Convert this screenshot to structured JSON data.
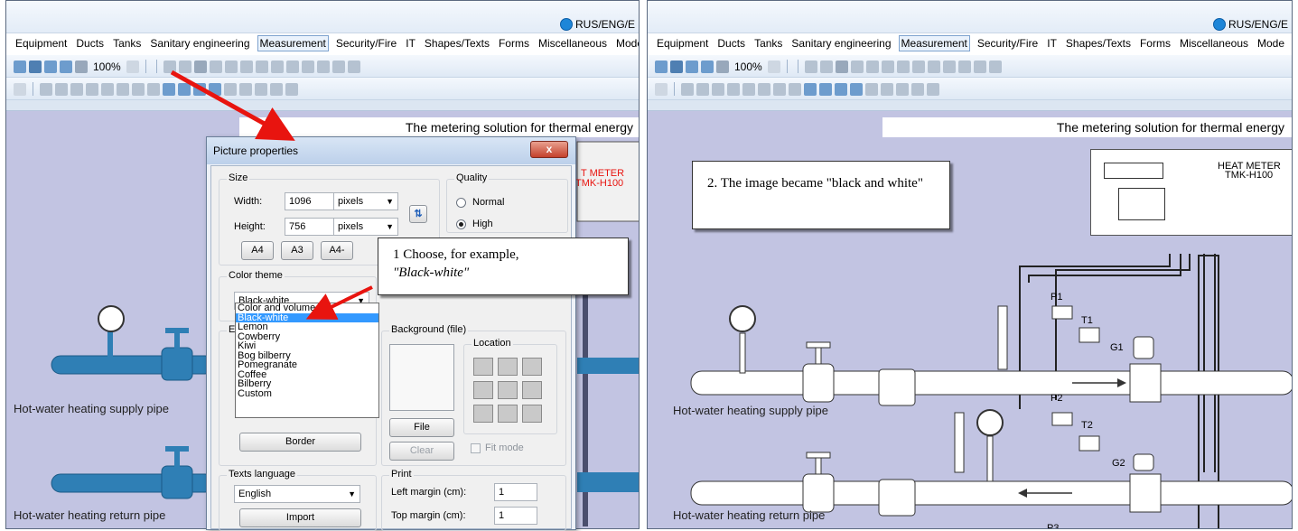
{
  "window": {
    "lang_selector": "RUS/ENG/E",
    "menu": [
      "Equipment",
      "Ducts",
      "Tanks",
      "Sanitary engineering",
      "Measurement",
      "Security/Fire",
      "IT",
      "Shapes/Texts",
      "Forms",
      "Miscellaneous",
      "Mode"
    ],
    "active_menu": "Measurement",
    "zoom": "100%"
  },
  "scheme": {
    "banner": "The metering solution for thermal energy",
    "supply_pipe": "Hot-water heating supply pipe",
    "return_pipe": "Hot-water heating return pipe",
    "device_title": "HEAT METER",
    "device_model": "TMK-H100",
    "device_title_partial": "T METER",
    "device_model_partial": "TMK-H100",
    "sensor_labels": [
      "P1",
      "T1",
      "G1",
      "P2",
      "T2",
      "G2",
      "P3"
    ]
  },
  "dialog": {
    "title": "Picture properties",
    "close": "x",
    "size_group": "Size",
    "width_label": "Width:",
    "width_value": "1096",
    "height_label": "Height:",
    "height_value": "756",
    "unit": "pixels",
    "btn_a4": "A4",
    "btn_a3": "A3",
    "btn_a4m": "A4-",
    "quality_group": "Quality",
    "quality_normal": "Normal",
    "quality_high": "High",
    "color_theme_group": "Color theme",
    "color_theme_value": "Black-white",
    "color_theme_options": [
      "Color and volume",
      "Black-white",
      "Lemon",
      "Cowberry",
      "Kiwi",
      "Bog bilberry",
      "Pomegranate",
      "Coffee",
      "Bilberry",
      "Custom"
    ],
    "color_theme_selected_index": 1,
    "bg_group_partial": "E",
    "bg_file_group": "Background (file)",
    "location_label": "Location",
    "btn_file": "File",
    "btn_clear": "Clear",
    "fit_mode": "Fit mode",
    "btn_border": "Border",
    "texts_language_group": "Texts language",
    "texts_language_value": "English",
    "btn_import": "Import",
    "print_group": "Print",
    "left_margin_label": "Left margin (cm):",
    "left_margin_value": "1",
    "top_margin_label": "Top margin (cm):",
    "top_margin_value": "1"
  },
  "callouts": {
    "step1_prefix": "1 Choose, for example,",
    "step1_emph": "\"Black-white\"",
    "step2": "2. The image became \"black and white\""
  },
  "colors": {
    "canvas": "#c2c4e2",
    "pipe_color": "#2f7fb5",
    "pipe_bw": "#ffffff",
    "arrow": "#e8140f",
    "highlight": "#3399ff"
  }
}
